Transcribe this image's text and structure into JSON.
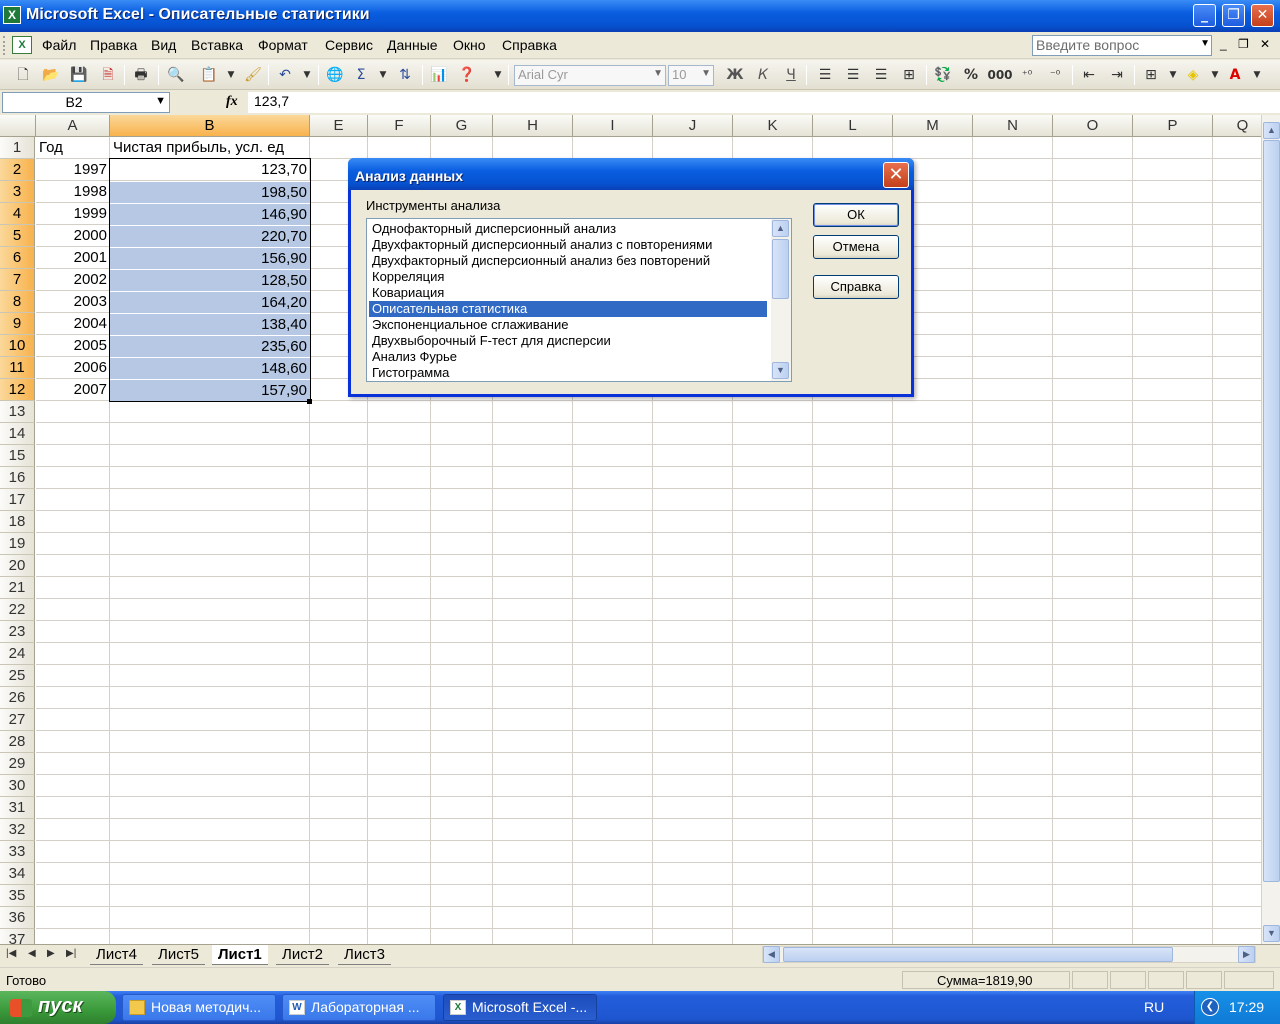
{
  "window": {
    "title": "Microsoft Excel - Описательные статистики",
    "app_icon_letter": "X"
  },
  "menu": {
    "items": [
      "Файл",
      "Правка",
      "Вид",
      "Вставка",
      "Формат",
      "Сервис",
      "Данные",
      "Окно",
      "Справка"
    ],
    "ask_placeholder": "Введите вопрос"
  },
  "toolbar": {
    "font_name": "Arial Cyr",
    "font_size": "10",
    "bold": "Ж",
    "italic": "К",
    "underline": "Ч",
    "percent": "%",
    "thousands": "000",
    "sum_symbol": "Σ"
  },
  "formula_bar": {
    "name_box": "B2",
    "fx_label": "fx",
    "value": "123,7"
  },
  "grid": {
    "columns": [
      "A",
      "B",
      "E",
      "F",
      "G",
      "H",
      "I",
      "J",
      "K",
      "L",
      "M",
      "N",
      "O",
      "P",
      "Q"
    ],
    "selected_column": "B",
    "row_numbers": [
      "1",
      "2",
      "3",
      "4",
      "5",
      "6",
      "7",
      "8",
      "9",
      "10",
      "11",
      "12",
      "13",
      "14",
      "15",
      "16",
      "17",
      "18",
      "19",
      "20",
      "21",
      "22",
      "23",
      "24",
      "25",
      "26",
      "27",
      "28",
      "29",
      "30",
      "31",
      "32",
      "33",
      "34",
      "35",
      "36",
      "37"
    ],
    "header_row": {
      "a": "Год",
      "b": "Чистая прибыль, усл. ед"
    },
    "data_rows": [
      {
        "a": "1997",
        "b": "123,70"
      },
      {
        "a": "1998",
        "b": "198,50"
      },
      {
        "a": "1999",
        "b": "146,90"
      },
      {
        "a": "2000",
        "b": "220,70"
      },
      {
        "a": "2001",
        "b": "156,90"
      },
      {
        "a": "2002",
        "b": "128,50"
      },
      {
        "a": "2003",
        "b": "164,20"
      },
      {
        "a": "2004",
        "b": "138,40"
      },
      {
        "a": "2005",
        "b": "235,60"
      },
      {
        "a": "2006",
        "b": "148,60"
      },
      {
        "a": "2007",
        "b": "157,90"
      }
    ]
  },
  "sheet_tabs": {
    "tabs": [
      "Лист4",
      "Лист5",
      "Лист1",
      "Лист2",
      "Лист3"
    ],
    "active": "Лист1"
  },
  "status_bar": {
    "ready": "Готово",
    "sum": "Сумма=1819,90"
  },
  "dialog": {
    "title": "Анализ данных",
    "list_label": "Инструменты анализа",
    "tools": [
      "Однофакторный дисперсионный анализ",
      "Двухфакторный дисперсионный анализ с повторениями",
      "Двухфакторный дисперсионный анализ без повторений",
      "Корреляция",
      "Ковариация",
      "Описательная статистика",
      "Экспоненциальное сглаживание",
      "Двухвыборочный F-тест для дисперсии",
      "Анализ Фурье",
      "Гистограмма"
    ],
    "selected_tool": "Описательная статистика",
    "ok_label": "ОК",
    "cancel_label": "Отмена",
    "help_label": "Справка"
  },
  "taskbar": {
    "start_label": "пуск",
    "buttons": [
      {
        "label": "Новая методич...",
        "icon": "folder-icon"
      },
      {
        "label": "Лабораторная ...",
        "icon": "word-icon"
      },
      {
        "label": "Microsoft Excel -...",
        "icon": "excel-icon"
      }
    ],
    "active_button": "Microsoft Excel -...",
    "language": "RU",
    "clock": "17:29"
  },
  "colors": {
    "titlebar_blue": "#0a5ee0",
    "selection_blue": "#b6c8e4",
    "selected_header_orange": "#f8b24d",
    "list_selection": "#316ac5",
    "start_green": "#3a9a3a"
  }
}
